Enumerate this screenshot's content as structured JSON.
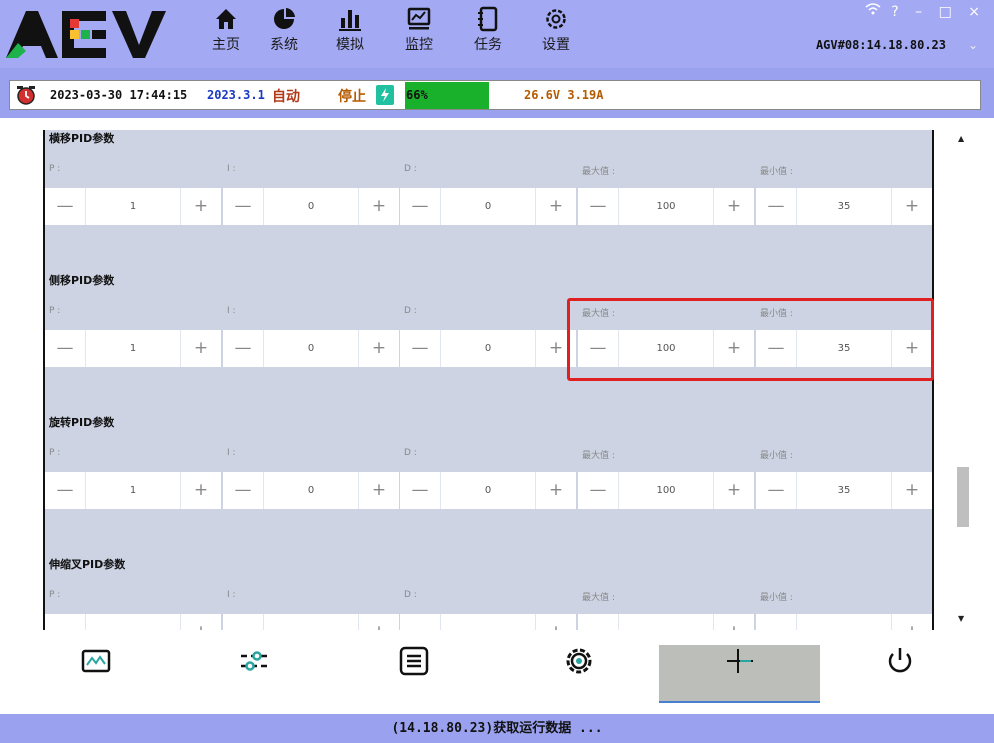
{
  "app": {
    "logo_text": "AGV",
    "nav": [
      {
        "label": "主页",
        "icon": "home-icon"
      },
      {
        "label": "系统",
        "icon": "pie-chart-icon"
      },
      {
        "label": "模拟",
        "icon": "bar-chart-icon"
      },
      {
        "label": "监控",
        "icon": "monitor-icon"
      },
      {
        "label": "任务",
        "icon": "task-icon"
      },
      {
        "label": "设置",
        "icon": "settings-icon"
      }
    ],
    "window_controls": {
      "wifi": "wifi-icon",
      "help": "?",
      "minimize": "–",
      "maximize": "□",
      "close": "×"
    },
    "agv_id": "AGV#08:14.18.80.23"
  },
  "status": {
    "datetime": "2023-03-30 17:44:15",
    "version": "2023.3.1",
    "mode": "自动",
    "state": "停止",
    "battery_percent": "66%",
    "voltage_current": "26.6V 3.19A"
  },
  "colors": {
    "battery_fill": "#19b02b",
    "highlight": "#e02020",
    "header_bg": "#a3a9f2"
  },
  "groups": [
    {
      "title": "横移PID参数",
      "fields": [
        {
          "label": "P :",
          "value": "1"
        },
        {
          "label": "I :",
          "value": "0"
        },
        {
          "label": "D :",
          "value": "0"
        },
        {
          "label": "最大值 :",
          "value": "100"
        },
        {
          "label": "最小值 :",
          "value": "35"
        }
      ]
    },
    {
      "title": "侧移PID参数",
      "fields": [
        {
          "label": "P :",
          "value": "1"
        },
        {
          "label": "I :",
          "value": "0"
        },
        {
          "label": "D :",
          "value": "0"
        },
        {
          "label": "最大值 :",
          "value": "100"
        },
        {
          "label": "最小值 :",
          "value": "35"
        }
      ]
    },
    {
      "title": "旋转PID参数",
      "fields": [
        {
          "label": "P :",
          "value": "1"
        },
        {
          "label": "I :",
          "value": "0"
        },
        {
          "label": "D :",
          "value": "0"
        },
        {
          "label": "最大值 :",
          "value": "100"
        },
        {
          "label": "最小值 :",
          "value": "35"
        }
      ]
    },
    {
      "title": "伸缩叉PID参数",
      "fields": [
        {
          "label": "P :",
          "value": ""
        },
        {
          "label": "I :",
          "value": ""
        },
        {
          "label": "D :",
          "value": ""
        },
        {
          "label": "最大值 :",
          "value": ""
        },
        {
          "label": "最小值 :",
          "value": ""
        }
      ]
    }
  ],
  "stepper": {
    "minus": "—",
    "plus": "+"
  },
  "toolbar": [
    {
      "icon": "chart-monitor-icon"
    },
    {
      "icon": "sliders-icon"
    },
    {
      "icon": "list-icon"
    },
    {
      "icon": "gear-icon"
    },
    {
      "icon": "crosshair-icon",
      "active": true
    },
    {
      "icon": "power-icon"
    }
  ],
  "footer": {
    "message": "(14.18.80.23)获取运行数据 ..."
  }
}
